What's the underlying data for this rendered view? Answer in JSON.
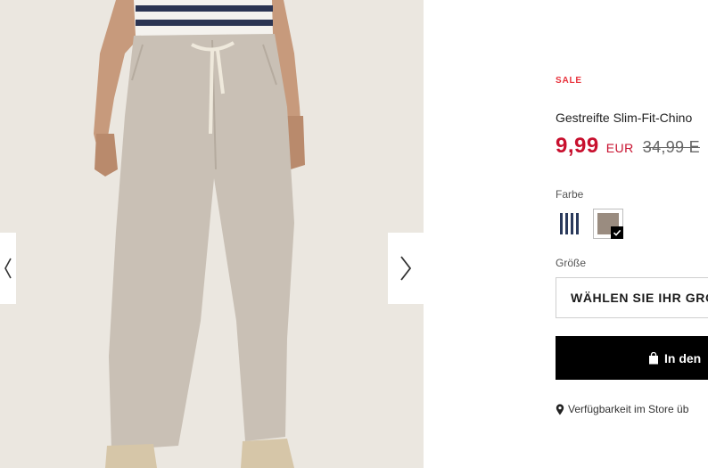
{
  "gallery": {
    "image_description": "",
    "prev_icon": "chevron-left-icon",
    "next_icon": "chevron-right-icon"
  },
  "product": {
    "badge": "SALE",
    "title": "Gestreifte Slim-Fit-Chino",
    "price": {
      "current": "9,99",
      "currency": "EUR",
      "old": "34,99 E"
    },
    "color": {
      "label": "Farbe",
      "options": [
        {
          "name": "stripe-navy",
          "selected": false
        },
        {
          "name": "stone",
          "selected": true
        }
      ]
    },
    "size": {
      "label": "Größe",
      "placeholder": "WÄHLEN SIE IHR GRÖ"
    },
    "add_to_cart": {
      "label": "In den",
      "icon": "shopping-bag-icon"
    },
    "store_availability": {
      "label": "Verfügbarkeit im Store üb",
      "icon": "map-pin-icon"
    }
  },
  "colors": {
    "sale": "#e8323c",
    "price": "#c8102e",
    "cta": "#000000"
  }
}
